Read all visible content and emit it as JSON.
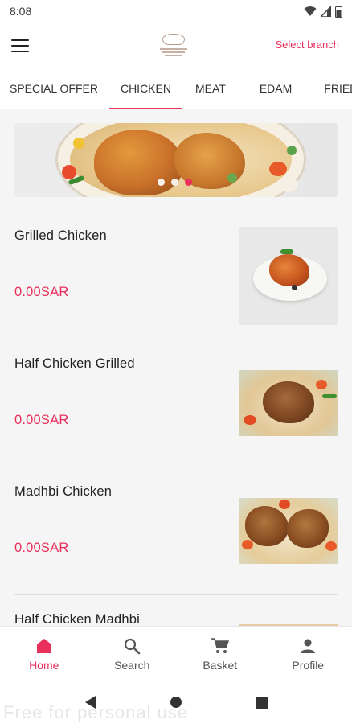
{
  "status_bar": {
    "time": "8:08"
  },
  "app_bar": {
    "select_branch": "Select branch"
  },
  "tabs": [
    {
      "label": "SPECIAL OFFER"
    },
    {
      "label": "CHICKEN"
    },
    {
      "label": "MEAT"
    },
    {
      "label": "EDAM"
    },
    {
      "label": "FRIED"
    }
  ],
  "banner": {
    "pages": 3,
    "active_page": 3
  },
  "items": [
    {
      "name": "Grilled Chicken",
      "price": "0.00SAR"
    },
    {
      "name": "Half Chicken Grilled",
      "price": "0.00SAR"
    },
    {
      "name": "Madhbi Chicken",
      "price": "0.00SAR"
    },
    {
      "name": "Half Chicken Madhbi",
      "price": ""
    }
  ],
  "bottom_nav": [
    {
      "label": "Home",
      "icon": "home-icon"
    },
    {
      "label": "Search",
      "icon": "search-icon"
    },
    {
      "label": "Basket",
      "icon": "cart-icon"
    },
    {
      "label": "Profile",
      "icon": "person-icon"
    }
  ],
  "watermark": "Free for personal use",
  "colors": {
    "accent": "#e8305a"
  }
}
